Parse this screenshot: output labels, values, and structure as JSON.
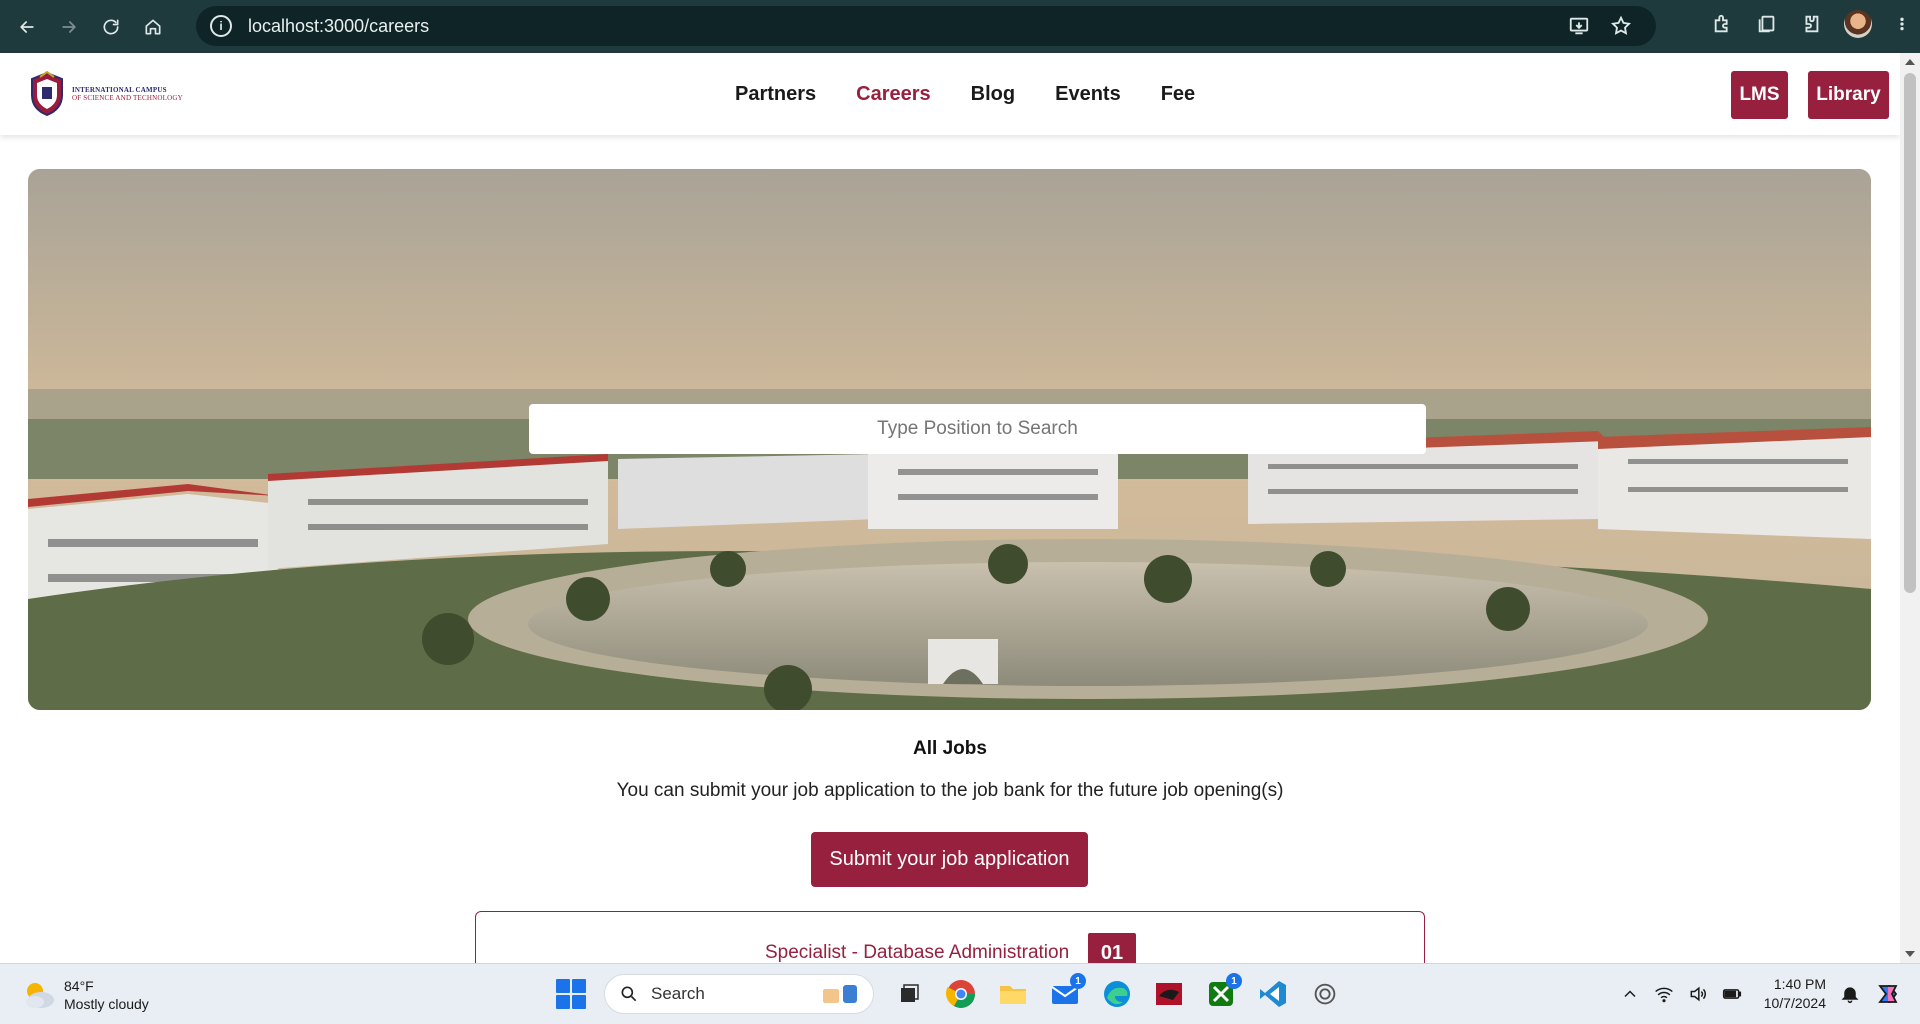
{
  "browser": {
    "url": "localhost:3000/careers"
  },
  "header": {
    "logo_line1": "INTERNATIONAL CAMPUS",
    "logo_line2": "OF SCIENCE AND TECHNOLOGY",
    "nav": [
      {
        "label": "Partners",
        "active": false
      },
      {
        "label": "Careers",
        "active": true
      },
      {
        "label": "Blog",
        "active": false
      },
      {
        "label": "Events",
        "active": false
      },
      {
        "label": "Fee",
        "active": false
      }
    ],
    "lms_label": "LMS",
    "library_label": "Library"
  },
  "hero": {
    "search_placeholder": "Type Position to Search"
  },
  "jobs": {
    "heading": "All Jobs",
    "note": "You can submit your job application to the job bank for the future job opening(s)",
    "submit_label": "Submit your job application",
    "items": [
      {
        "title": "Specialist - Database Administration",
        "count": "01"
      }
    ]
  },
  "taskbar": {
    "weather_temp": "84°F",
    "weather_desc": "Mostly cloudy",
    "search_label": "Search",
    "mail_badge": "1",
    "xbox_badge": "1",
    "time": "1:40 PM",
    "date": "10/7/2024"
  },
  "colors": {
    "brand": "#97203f",
    "chrome_bg": "#1f3a3d"
  }
}
